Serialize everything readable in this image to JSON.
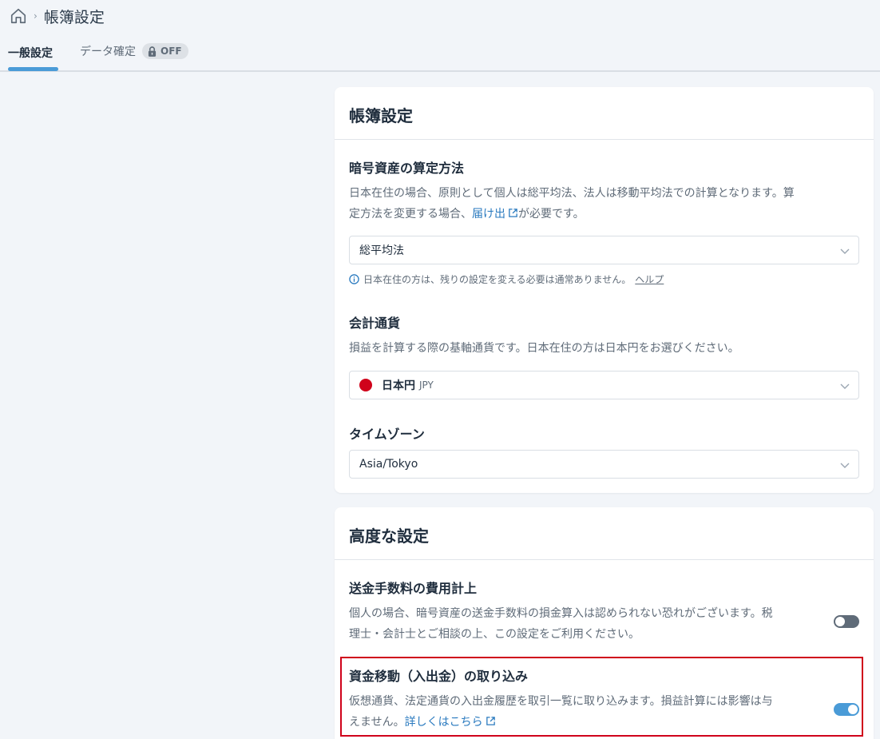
{
  "breadcrumb": {
    "separator": "›",
    "title": "帳簿設定"
  },
  "tabs": {
    "general": "一般設定",
    "confirm": "データ確定",
    "confirm_badge": "OFF"
  },
  "card1": {
    "title": "帳簿設定",
    "method": {
      "title": "暗号資産の算定方法",
      "desc_1": "日本在住の場合、原則として個人は総平均法、法人は移動平均法での計算となります。算",
      "desc_2_pre": "定方法を変更する場合、",
      "desc_2_link": "届け出",
      "desc_2_post": "が必要です。",
      "selected": "総平均法",
      "note_pre": "日本在住の方は、残りの設定を変える必要は通常ありません。",
      "note_link": "ヘルプ"
    },
    "currency": {
      "title": "会計通貨",
      "desc": "損益を計算する際の基軸通貨です。日本在住の方は日本円をお選びください。",
      "selected_name": "日本円",
      "selected_code": "JPY"
    },
    "timezone": {
      "title": "タイムゾーン",
      "selected": "Asia/Tokyo"
    }
  },
  "card2": {
    "title": "高度な設定",
    "fee": {
      "title": "送金手数料の費用計上",
      "desc_1": "個人の場合、暗号資産の送金手数料の損金算入は認められない恐れがございます。税",
      "desc_2": "理士・会計士とご相談の上、この設定をご利用ください。",
      "enabled": false
    },
    "transfer": {
      "title": "資金移動（入出金）の取り込み",
      "desc_1": "仮想通貨、法定通貨の入出金履歴を取引一覧に取り込みます。損益計算には影響は与",
      "desc_2_pre": "えません。",
      "desc_2_link": "詳しくはこちら",
      "enabled": true
    }
  },
  "colors": {
    "accent": "#4a9bd7",
    "link": "#2a7abf",
    "highlight_border": "#d0021b",
    "toggle_off": "#5f6b78"
  }
}
